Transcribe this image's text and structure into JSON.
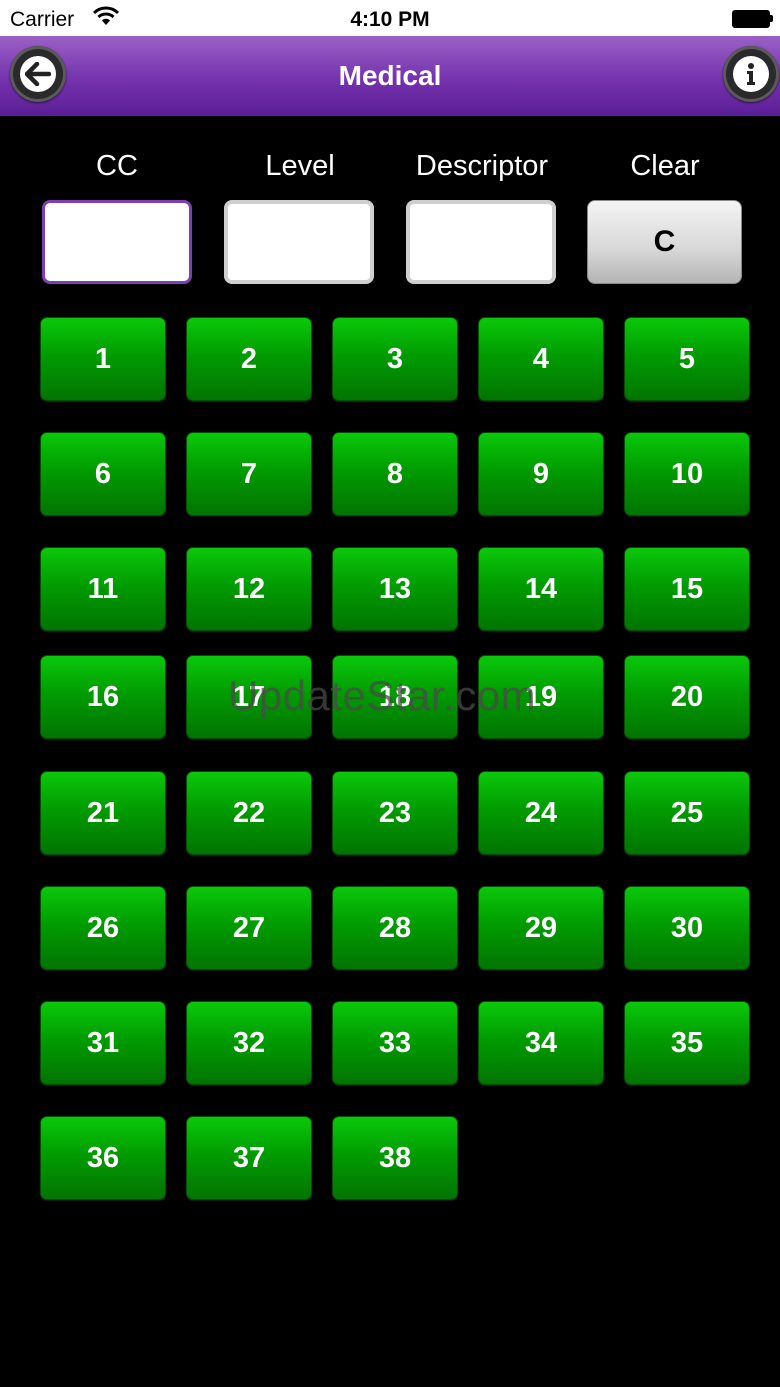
{
  "status": {
    "carrier": "Carrier",
    "time": "4:10 PM"
  },
  "nav": {
    "title": "Medical",
    "back_icon": "back-arrow-icon",
    "info_icon": "info-icon"
  },
  "headers": {
    "cc": "CC",
    "level": "Level",
    "descriptor": "Descriptor",
    "clear": "Clear"
  },
  "fields": {
    "cc_value": "",
    "level_value": "",
    "descriptor_value": ""
  },
  "clear_button": {
    "label": "C"
  },
  "keys": [
    "1",
    "2",
    "3",
    "4",
    "5",
    "6",
    "7",
    "8",
    "9",
    "10",
    "11",
    "12",
    "13",
    "14",
    "15",
    "16",
    "17",
    "18",
    "19",
    "20",
    "21",
    "22",
    "23",
    "24",
    "25",
    "26",
    "27",
    "28",
    "29",
    "30",
    "31",
    "32",
    "33",
    "34",
    "35",
    "36",
    "37",
    "38"
  ],
  "watermark": "UpdateStar.com",
  "colors": {
    "nav_purple": "#7432ad",
    "key_green": "#019c01",
    "active_border": "#7e3fb4"
  }
}
